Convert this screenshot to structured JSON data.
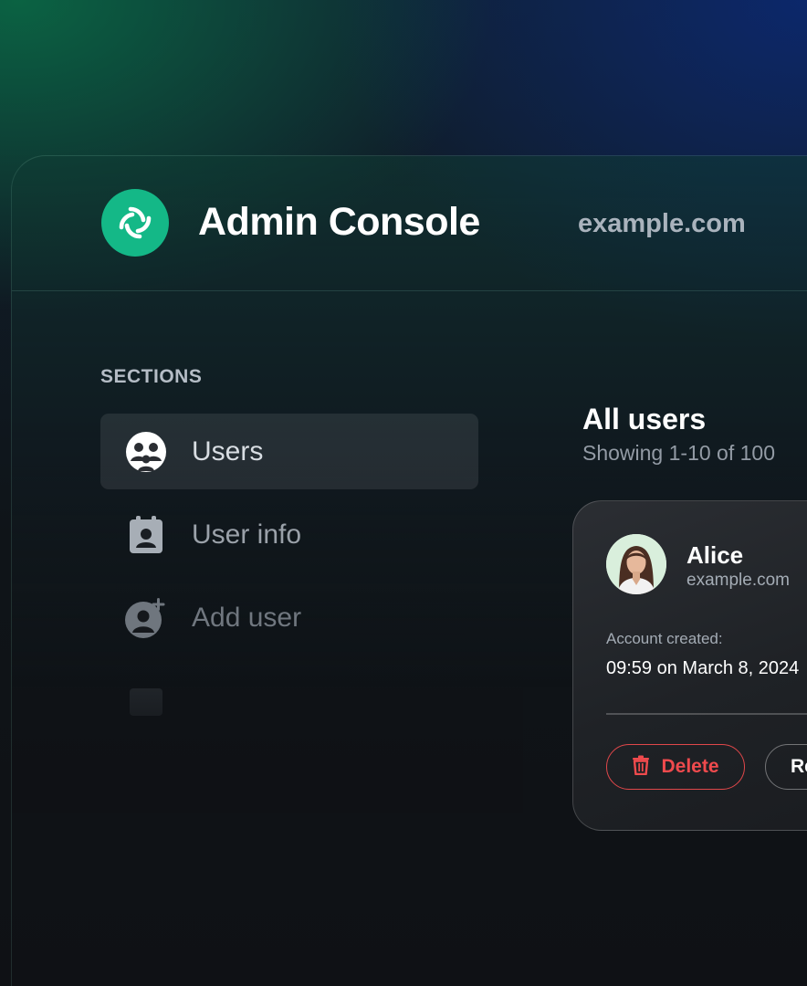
{
  "header": {
    "app_title": "Admin Console",
    "server_name": "example.com"
  },
  "sidebar": {
    "heading": "SECTIONS",
    "items": [
      {
        "label": "Users",
        "icon": "users-group-icon",
        "active": true
      },
      {
        "label": "User info",
        "icon": "user-badge-icon",
        "active": false
      },
      {
        "label": "Add user",
        "icon": "add-user-icon",
        "active": false
      }
    ]
  },
  "main": {
    "title": "All users",
    "subtitle": "Showing 1-10 of 100",
    "user_card": {
      "name": "Alice",
      "server": "example.com",
      "created_label": "Account created:",
      "created_value": "09:59 on March 8, 2024",
      "delete_label": "Delete",
      "second_label": "Re"
    }
  },
  "colors": {
    "brand": "#14b887",
    "danger": "#ef4a4d",
    "background": "#0f1115"
  }
}
